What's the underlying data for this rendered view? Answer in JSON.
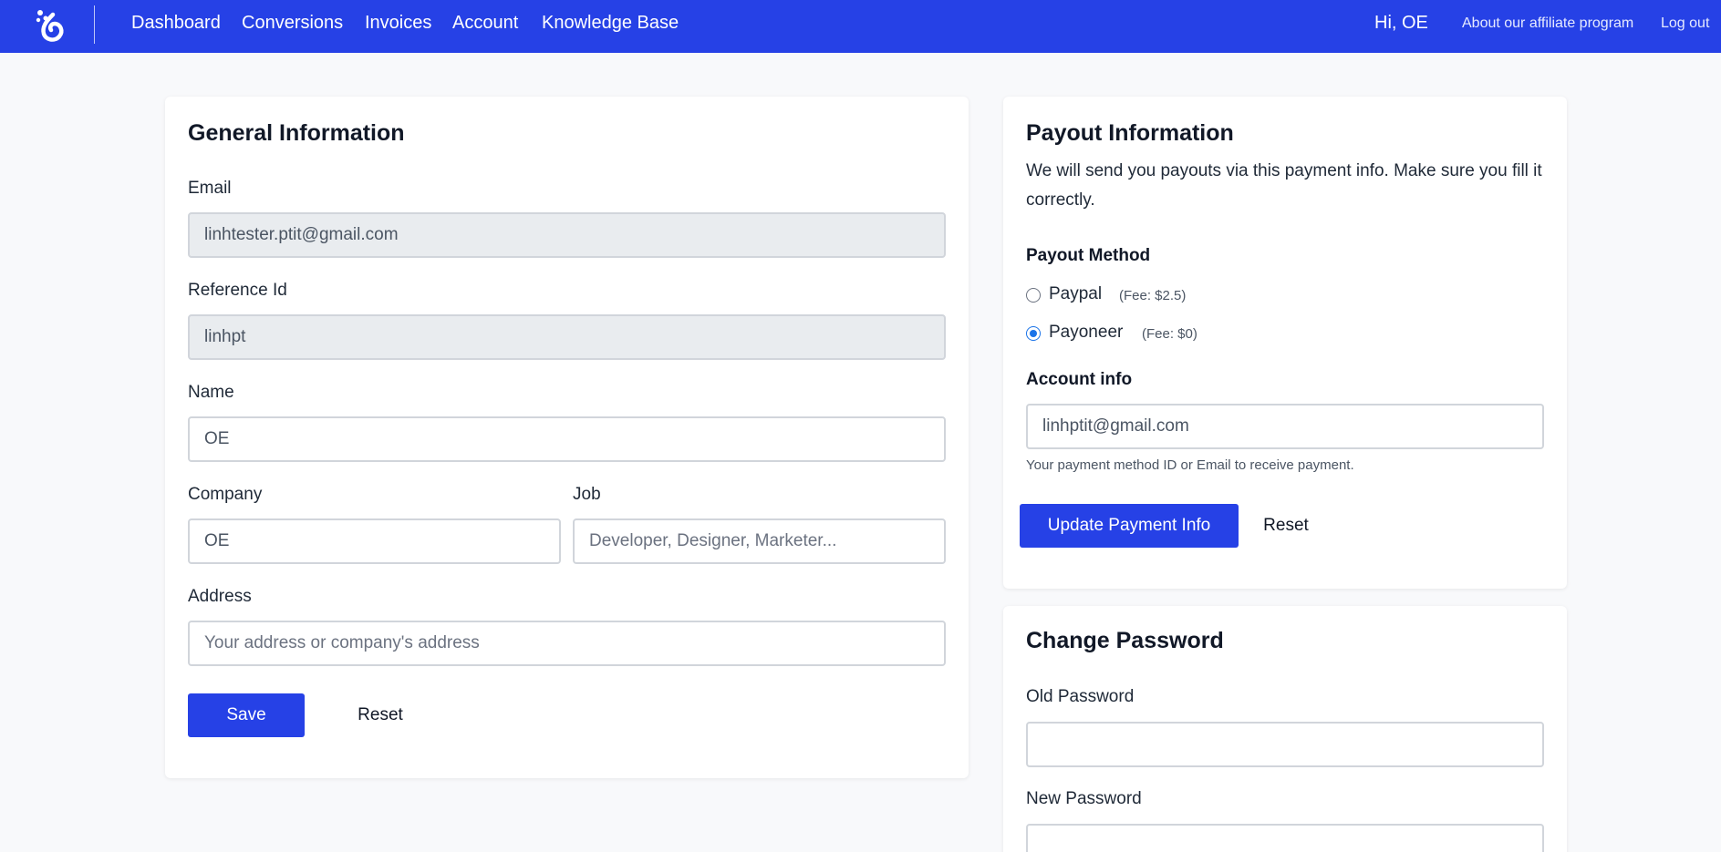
{
  "nav": {
    "links": [
      "Dashboard",
      "Conversions",
      "Invoices",
      "Account",
      "Knowledge Base"
    ],
    "greeting": "Hi, OE",
    "affiliate_link": "About our affiliate program",
    "logout": "Log out",
    "color": "#2641e6"
  },
  "general": {
    "title": "General Information",
    "email_label": "Email",
    "email_value": "linhtester.ptit@gmail.com",
    "ref_label": "Reference Id",
    "ref_value": "linhpt",
    "name_label": "Name",
    "name_value": "OE",
    "company_label": "Company",
    "company_value": "OE",
    "job_label": "Job",
    "job_placeholder": "Developer, Designer, Marketer...",
    "address_label": "Address",
    "address_placeholder": "Your address or company's address",
    "save_label": "Save",
    "reset_label": "Reset"
  },
  "payout": {
    "title": "Payout Information",
    "description": "We will send you payouts via this payment info. Make sure you fill it correctly.",
    "method_label": "Payout Method",
    "options": [
      {
        "label": "Paypal",
        "fee": "(Fee: $2.5)",
        "checked": false
      },
      {
        "label": "Payoneer",
        "fee": "(Fee: $0)",
        "checked": true
      }
    ],
    "account_label": "Account info",
    "account_value": "linhptit@gmail.com",
    "account_help": "Your payment method ID or Email to receive payment.",
    "update_label": "Update Payment Info",
    "reset_label": "Reset"
  },
  "password": {
    "title": "Change Password",
    "old_label": "Old Password",
    "new_label": "New Password"
  }
}
